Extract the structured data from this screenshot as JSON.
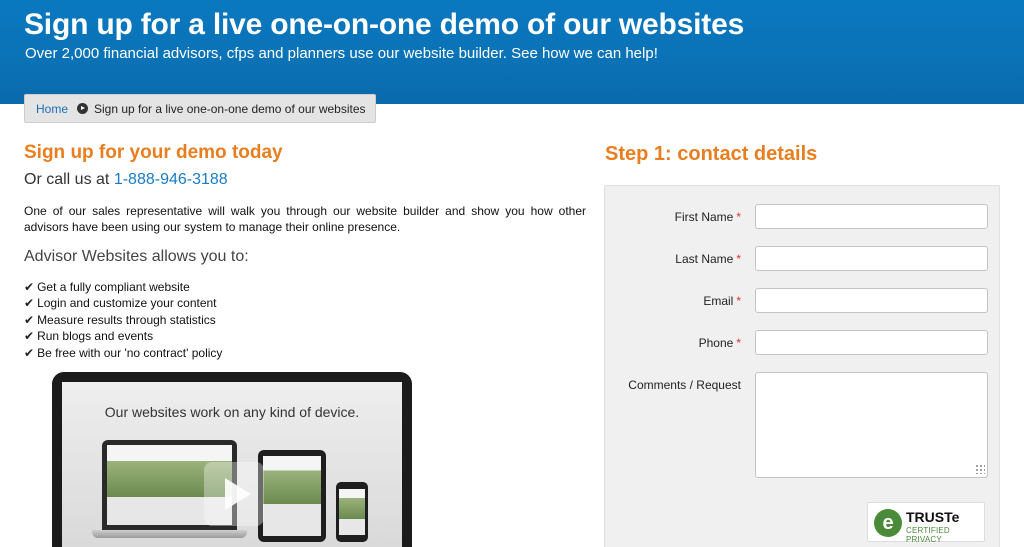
{
  "hero": {
    "title": "Sign up for a live one-on-one demo of our websites",
    "subtitle": "Over 2,000 financial advisors, cfps and planners use our website builder. See how we can help!"
  },
  "breadcrumb": {
    "home": "Home",
    "current": "Sign up for a live one-on-one demo of our websites"
  },
  "left": {
    "heading": "Sign up for your demo today",
    "call_prefix": "Or call us at",
    "phone": "1-888-946-3188",
    "intro": "One of our sales representative will walk you through our website builder and show you how other advisors have been using our system to manage their online presence.",
    "allows_heading": "Advisor Websites allows you to:",
    "features": [
      "Get a fully compliant website",
      "Login and customize your content",
      "Measure results through statistics",
      "Run blogs and events",
      "Be free with our 'no contract' policy"
    ],
    "video_caption": "Our websites work on any kind of device."
  },
  "form": {
    "heading": "Step 1: contact details",
    "fields": {
      "first_name": {
        "label": "First Name",
        "required": "*",
        "value": ""
      },
      "last_name": {
        "label": "Last Name",
        "required": "*",
        "value": ""
      },
      "email": {
        "label": "Email",
        "required": "*",
        "value": ""
      },
      "phone": {
        "label": "Phone",
        "required": "*",
        "value": ""
      },
      "comments": {
        "label": "Comments / Request",
        "value": ""
      }
    },
    "seal": {
      "letter": "e",
      "brand": "TRUSTe",
      "tagline": "CERTIFIED PRIVACY"
    }
  },
  "colors": {
    "hero_blue": "#0b72b6",
    "accent_orange": "#e87e1f",
    "link_blue": "#1a7cc4",
    "required_red": "#dd3333"
  }
}
